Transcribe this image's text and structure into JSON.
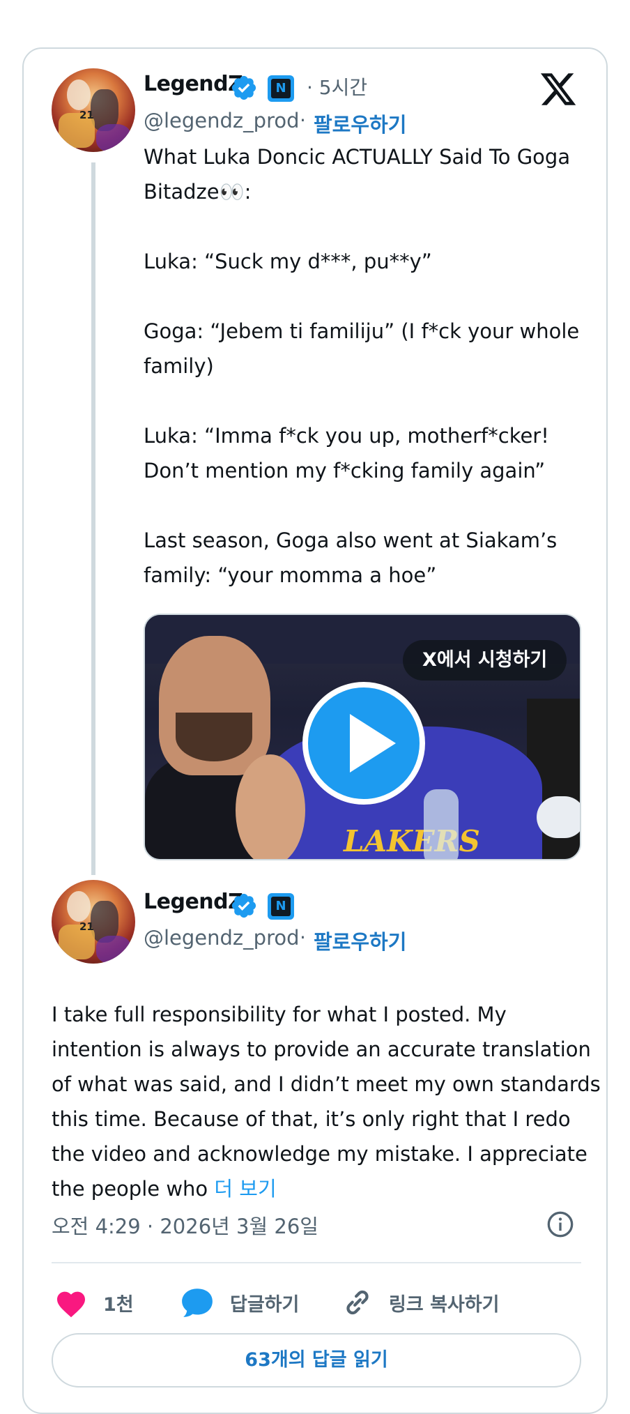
{
  "tweet": {
    "author_name": "LegendZ",
    "handle": "@legendz_prod",
    "time_ago": "· 5시간",
    "follow_label": "팔로우하기",
    "text": "What Luka Doncic ACTUALLY Said To Goga Bitadze👀:\n\nLuka: “Suck my d***, pu**y”\n\nGoga: “Jebem ti familiju” (I f*ck your whole family)\n\nLuka: “Imma f*ck you up, motherf*cker! Don’t mention my f*cking family again”\n\nLast season, Goga also went at Siakam’s family: “your momma a hoe”",
    "media": {
      "watch_label": "X에서 시청하기",
      "jersey_text": "LAKERS"
    }
  },
  "reply": {
    "author_name": "LegendZ",
    "handle": "@legendz_prod",
    "follow_label": "팔로우하기",
    "text": "I take full responsibility for what I posted. My intention is always to provide an accurate translation of what was said, and I didn’t meet my own standards this time. Because of that, it’s only right that I redo the video and acknowledge my mistake. I appreciate the people who ",
    "more_label": "더 보기",
    "timestamp": "오전 4:29 · 2026년 3월 26일"
  },
  "actions": {
    "like_count": "1천",
    "reply_label": "답글하기",
    "copy_link_label": "링크 복사하기",
    "read_replies_label": "63개의 답글 읽기"
  },
  "avatar_number": "21",
  "colors": {
    "accent": "#1d9bf0",
    "follow_blue": "#1d78c4",
    "like_pink": "#f91880",
    "muted": "#536471",
    "border": "#cfd9de"
  },
  "icons": [
    "verified-badge-icon",
    "automated-label-icon",
    "x-logo-icon",
    "play-icon",
    "info-icon",
    "heart-icon",
    "reply-bubble-icon",
    "link-icon"
  ]
}
